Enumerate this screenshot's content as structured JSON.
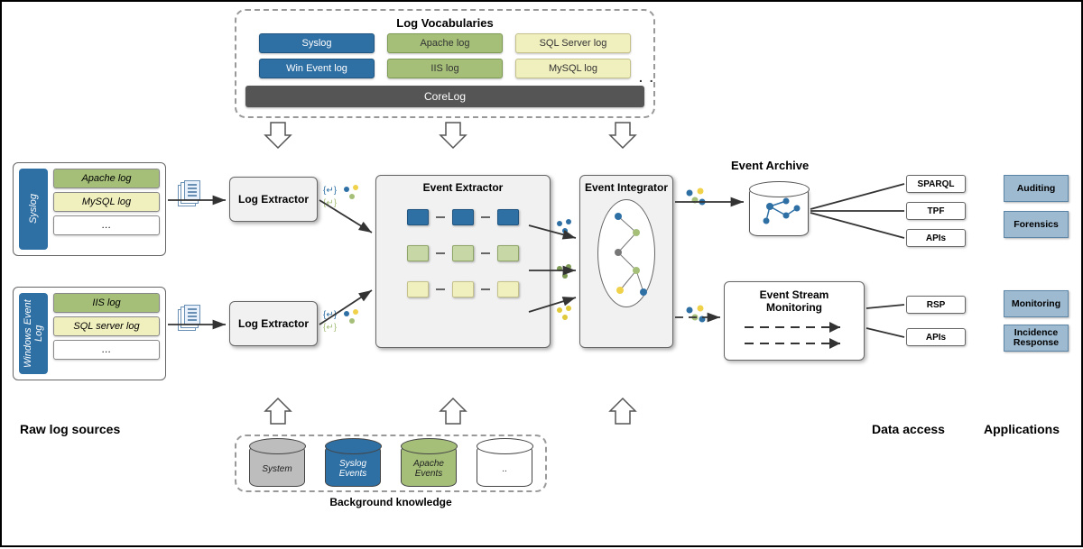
{
  "vocab": {
    "title": "Log Vocabularies",
    "chips": [
      "Syslog",
      "Apache log",
      "SQL Server log",
      "Win Event log",
      "IIS log",
      "MySQL log"
    ],
    "core": "CoreLog",
    "more": ". ."
  },
  "sources": {
    "label": "Raw log sources",
    "box1": {
      "spine": "Syslog",
      "items": [
        "Apache log",
        "MySQL log",
        "…"
      ]
    },
    "box2": {
      "spine": "Windows Event Log",
      "items": [
        "IIS log",
        "SQL server log",
        "…"
      ]
    }
  },
  "pipeline": {
    "logExtractor": "Log Extractor",
    "eventExtractor": "Event Extractor",
    "eventIntegrator": "Event Integrator"
  },
  "archive": {
    "title": "Event Archive"
  },
  "stream": {
    "title": "Event Stream Monitoring"
  },
  "apis": {
    "archive": [
      "SPARQL",
      "TPF",
      "APIs"
    ],
    "stream": [
      "RSP",
      "APIs"
    ]
  },
  "apps": {
    "label": "Applications",
    "items": [
      "Auditing",
      "Forensics",
      "Monitoring",
      "Incidence Response"
    ]
  },
  "dataAccessLabel": "Data access",
  "bk": {
    "title": "Background knowledge",
    "items": [
      "System",
      "Syslog Events",
      "Apache Events",
      ".."
    ]
  }
}
